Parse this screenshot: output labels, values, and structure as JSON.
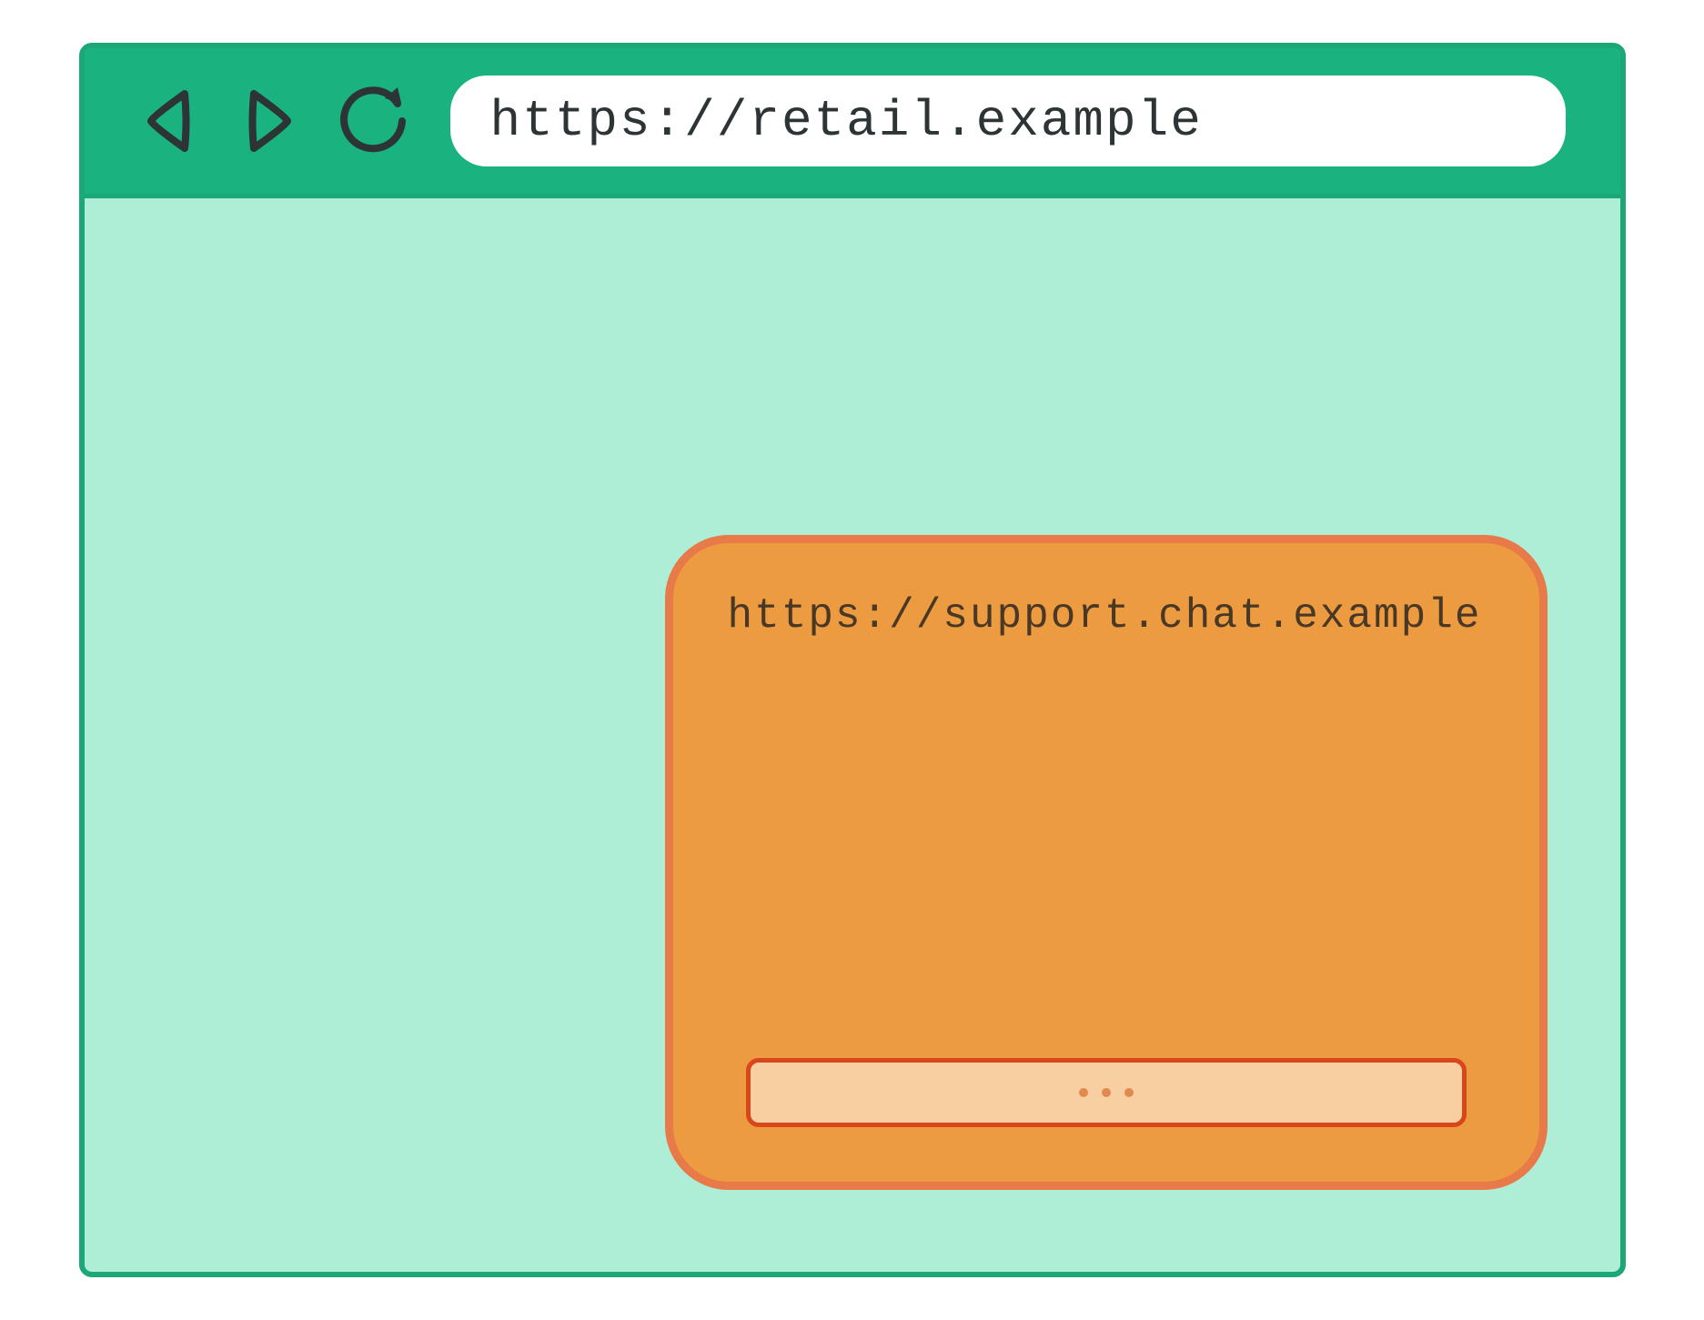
{
  "browser": {
    "url": "https://retail.example"
  },
  "chat_widget": {
    "origin": "https://support.chat.example"
  },
  "colors": {
    "browser_chrome": "#1ab27f",
    "browser_border": "#1ba876",
    "viewport_bg": "#aeeed6",
    "widget_bg": "#ed9b40",
    "widget_border": "#e87a4a",
    "input_bg": "#f8cfa0",
    "input_border": "#d9461c"
  }
}
